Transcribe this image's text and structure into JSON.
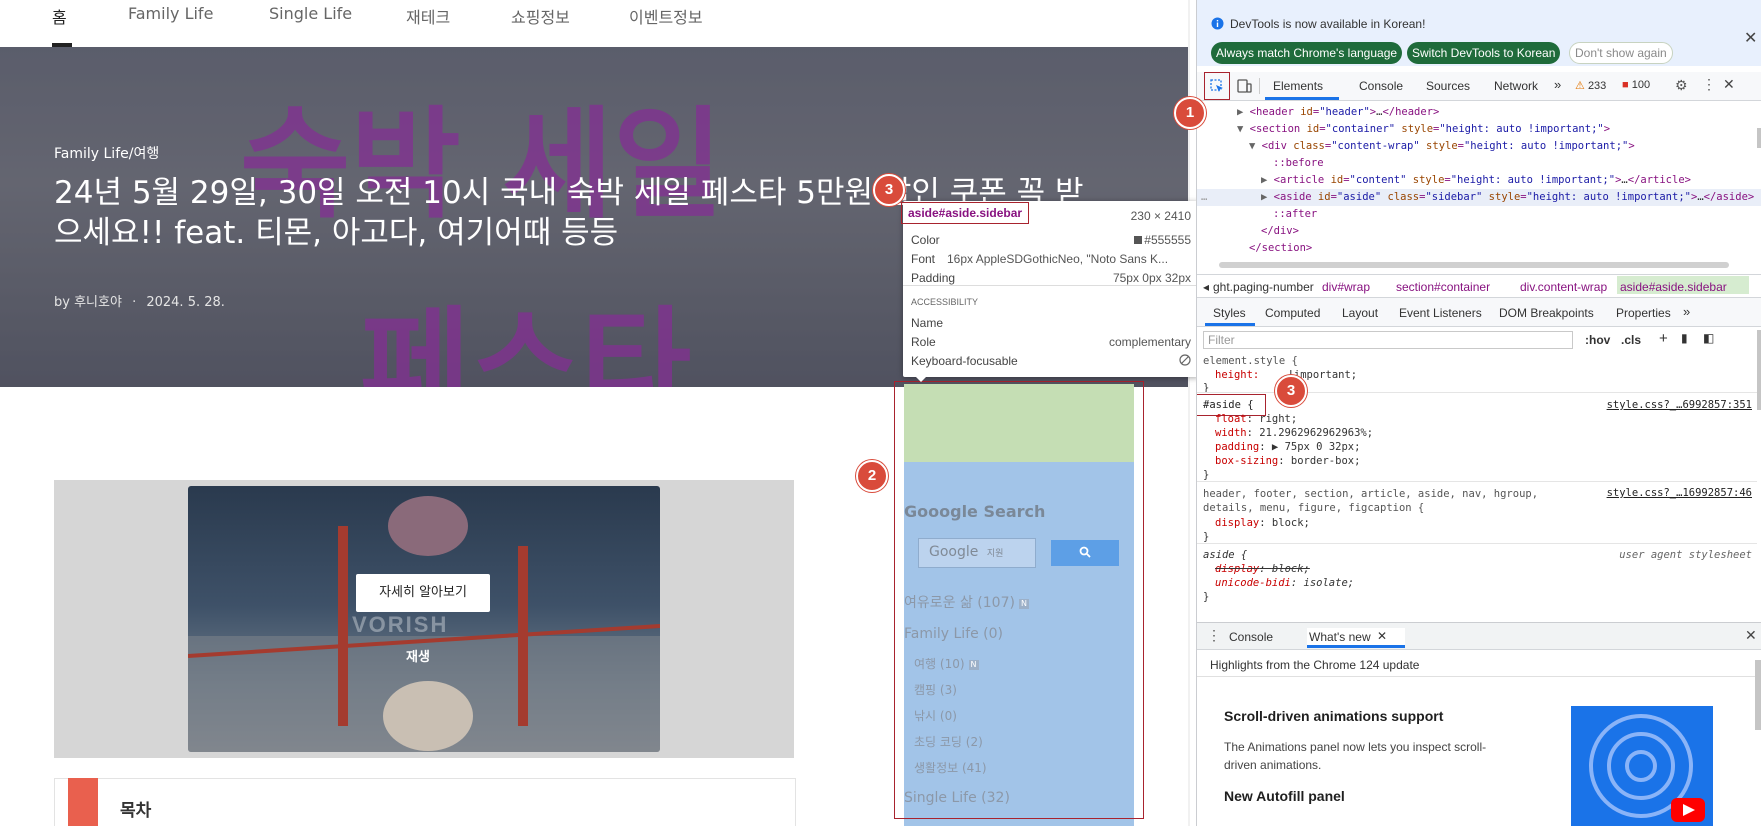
{
  "site": {
    "nav": [
      "홈",
      "Family Life",
      "Single Life",
      "재테크",
      "쇼핑정보",
      "이벤트정보"
    ],
    "hero": {
      "bg_text_1": "숙박 세일",
      "bg_text_2": "페스타",
      "category": "Family Life/여행",
      "title_line1": "24년 5월 29일, 30일 오전 10시 국내 숙박 세일 페스타 5만원 할인 쿠폰 꼭 받",
      "title_line2": "으세요!! feat. 티몬, 아고다, 여기어때 등등",
      "author_prefix": "by ",
      "author": "후니호야",
      "date": "2024. 5. 28."
    },
    "ad": {
      "button_label": "자세히 알아보기",
      "play_label": "재생",
      "watermark": "VORISH"
    },
    "toc_title": "목차",
    "sidebar": {
      "search_heading": "Gooogle Search",
      "search_placeholder": "Google",
      "search_sub": "지원",
      "categories": [
        {
          "label": "여유로운 삶 (107)",
          "new": true
        },
        {
          "label": "Family Life (0)",
          "new": false
        },
        {
          "label": "여행 (10)",
          "new": true
        },
        {
          "label": "캠핑 (3)",
          "new": false
        },
        {
          "label": "낚시 (0)",
          "new": false
        },
        {
          "label": "초딩 코딩 (2)",
          "new": false
        },
        {
          "label": "생활정보 (41)",
          "new": false
        },
        {
          "label": "Single Life (32)",
          "new": false
        }
      ],
      "new_mark": "N"
    }
  },
  "tooltip": {
    "selector": "aside#aside.sidebar",
    "size": "230 × 2410",
    "rows": [
      {
        "k": "Color",
        "v": "#555555"
      },
      {
        "k": "Font",
        "v": "16px AppleSDGothicNeo, \"Noto Sans K..."
      },
      {
        "k": "Padding",
        "v": "75px 0px 32px"
      }
    ],
    "accessibility_heading": "ACCESSIBILITY",
    "acc_rows": [
      {
        "k": "Name",
        "v": ""
      },
      {
        "k": "Role",
        "v": "complementary"
      },
      {
        "k": "Keyboard-focusable",
        "v": ""
      }
    ]
  },
  "devtools": {
    "info_text": "DevTools is now available in Korean!",
    "btn_always": "Always match Chrome's language",
    "btn_switch": "Switch DevTools to Korean",
    "btn_dont": "Don't show again",
    "tabs": [
      "Elements",
      "Console",
      "Sources",
      "Network"
    ],
    "warnings": "233",
    "errors": "100",
    "dom": [
      {
        "indent": 0,
        "html": "▶ <header id=\"header\">…</header>"
      },
      {
        "indent": 0,
        "html": "▼ <section id=\"container\" style=\"height: auto !important;\">"
      },
      {
        "indent": 1,
        "html": "▼ <div class=\"content-wrap\" style=\"height: auto !important;\">"
      },
      {
        "indent": 2,
        "html": "::before"
      },
      {
        "indent": 2,
        "html": "▶ <article id=\"content\" style=\"height: auto !important;\">…</article>"
      },
      {
        "indent": 2,
        "html": "▶ <aside id=\"aside\" class=\"sidebar\" style=\"height: auto !important;\">…</aside>"
      },
      {
        "indent": 2,
        "html": "::after"
      },
      {
        "indent": 1,
        "html": "</div>"
      },
      {
        "indent": 0,
        "html": "</section>"
      }
    ],
    "breadcrumbs": [
      "ght.paging-number",
      "div#wrap",
      "section#container",
      "div.content-wrap",
      "aside#aside.sidebar"
    ],
    "subtabs": [
      "Styles",
      "Computed",
      "Layout",
      "Event Listeners",
      "DOM Breakpoints",
      "Properties"
    ],
    "filter_placeholder": "Filter",
    "hov": ":hov",
    "cls": ".cls",
    "styles": {
      "element_style": "element.style {",
      "element_prop": "height: ",
      "element_val": "!important;",
      "aside_selector": "#aside {",
      "aside_source": "style.css?_…6992857:351",
      "aside_props": [
        {
          "p": "float",
          "v": "right;"
        },
        {
          "p": "width",
          "v": "21.2962962962963%;"
        },
        {
          "p": "padding",
          "v": "▶ 75px 0 32px;"
        },
        {
          "p": "box-sizing",
          "v": "border-box;"
        }
      ],
      "html5_selector": "header, footer, section, article, aside, nav, hgroup, details, menu, figure, figcaption {",
      "html5_source": "style.css?_…16992857:46",
      "html5_prop": {
        "p": "display",
        "v": "block;"
      },
      "ua_selector": "aside {",
      "ua_source": "user agent stylesheet",
      "ua_props": [
        {
          "p": "display",
          "v": "block;"
        },
        {
          "p": "unicode-bidi",
          "v": "isolate;"
        }
      ]
    },
    "drawer_tabs": [
      "Console",
      "What's new"
    ],
    "whatsnew_intro": "Highlights from the Chrome 124 update",
    "wn1_title": "Scroll-driven animations support",
    "wn1_body": "The Animations panel now lets you inspect scroll-driven animations.",
    "wn2_title": "New Autofill panel"
  },
  "annotations": [
    "1",
    "2",
    "3",
    "3",
    "3"
  ]
}
